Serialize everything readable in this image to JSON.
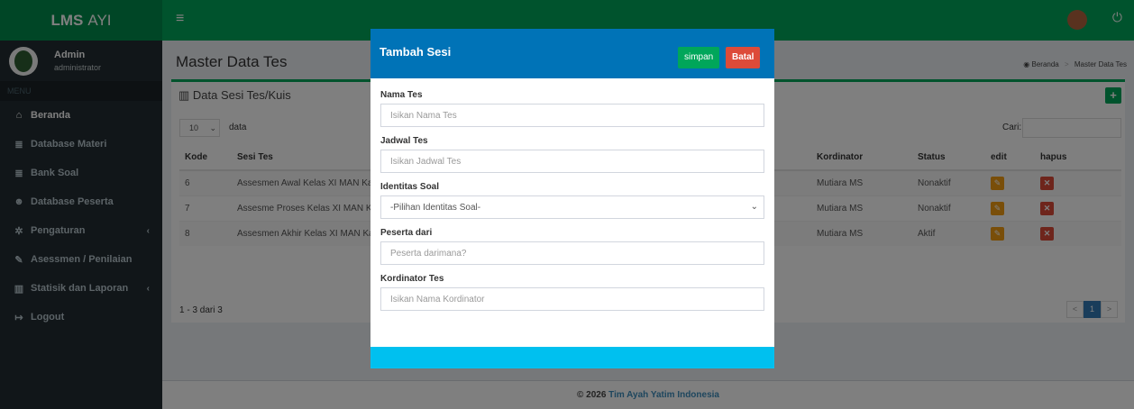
{
  "app": {
    "logo_bold": "LMS",
    "logo_light": "AYI"
  },
  "user": {
    "name": "Admin",
    "role": "administrator"
  },
  "sidebar": {
    "header": "MENU",
    "items": [
      {
        "icon": "home-icon",
        "label": "Beranda"
      },
      {
        "icon": "database-icon",
        "label": "Database Materi"
      },
      {
        "icon": "database-icon",
        "label": "Bank Soal"
      },
      {
        "icon": "users-icon",
        "label": "Database Peserta"
      },
      {
        "icon": "gear-icon",
        "label": "Pengaturan"
      },
      {
        "icon": "edit-icon",
        "label": "Asessmen / Penilaian"
      },
      {
        "icon": "bar-chart-icon",
        "label": "Statisik dan Laporan"
      },
      {
        "icon": "logout-icon",
        "label": "Logout"
      }
    ]
  },
  "page": {
    "title": "Master Data Tes",
    "breadcrumb": [
      "Beranda",
      "Master Data Tes"
    ]
  },
  "box": {
    "title": "Data Sesi Tes/Kuis",
    "length_value": "10",
    "length_label": "data",
    "search_label": "Cari:",
    "columns": [
      "Kode",
      "Sesi Tes",
      "Kordinator",
      "Status",
      "edit",
      "hapus"
    ],
    "rows": [
      {
        "kode": "6",
        "sesi": "Assesmen Awal Kelas XI MAN Ka",
        "kordinator": "Mutiara MS",
        "status": "Nonaktif"
      },
      {
        "kode": "7",
        "sesi": "Assesme Proses Kelas XI MAN Ka",
        "kordinator": "Mutiara MS",
        "status": "Nonaktif"
      },
      {
        "kode": "8",
        "sesi": "Assesmen Akhir Kelas XI MAN Ka",
        "kordinator": "Mutiara MS",
        "status": "Aktif"
      }
    ],
    "info": "1 - 3 dari 3",
    "pager": {
      "prev": "<",
      "page": "1",
      "next": ">"
    }
  },
  "footer": {
    "prefix": "© 2026",
    "link": "Tim Ayah Yatim Indonesia"
  },
  "modal": {
    "title": "Tambah Sesi",
    "save_label": "simpan",
    "cancel_label": "Batal",
    "fields": [
      {
        "label": "Nama Tes",
        "placeholder": "Isikan Nama Tes"
      },
      {
        "label": "Jadwal Tes",
        "placeholder": "Isikan Jadwal Tes"
      },
      {
        "label": "Identitas Soal",
        "selected": "-Pilihan Identitas Soal-"
      },
      {
        "label": "Peserta dari",
        "placeholder": "Peserta darimana?"
      },
      {
        "label": "Kordinator Tes",
        "placeholder": "Isikan Nama Kordinator"
      }
    ]
  },
  "colors": {
    "navbar": "#00a65a",
    "logo_bg": "#008d4c",
    "sidebar_bg": "#222d32",
    "modal_header": "#0073b7",
    "modal_footer": "#00c0ef",
    "edit_btn": "#f39c12",
    "delete_btn": "#dd4b39"
  }
}
